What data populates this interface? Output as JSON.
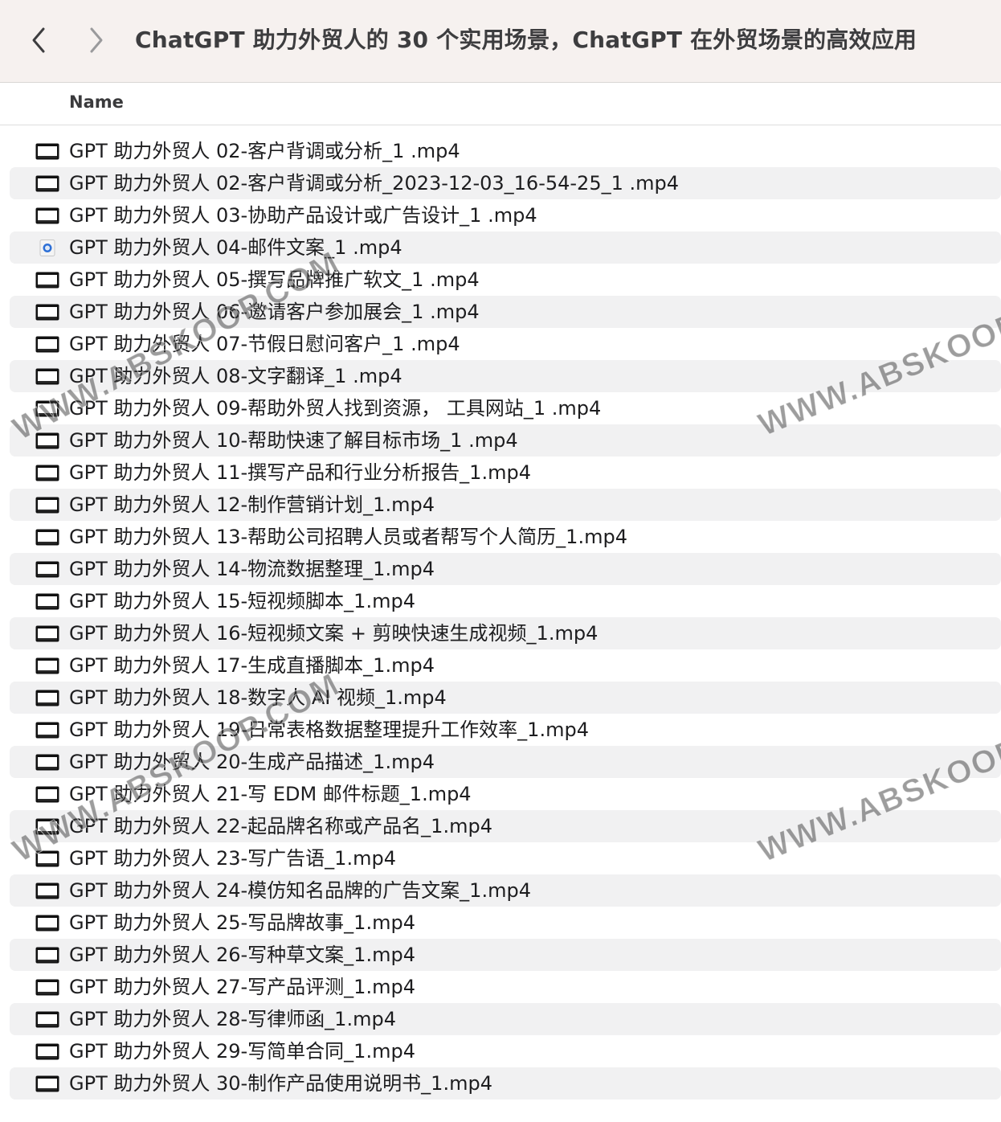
{
  "window": {
    "title": "ChatGPT 助力外贸人的 30 个实用场景，ChatGPT 在外贸场景的高效应用"
  },
  "columns": {
    "name": "Name"
  },
  "files": [
    {
      "name": "GPT 助力外贸人 02-客户背调或分析_1 .mp4",
      "icon": "video-file-icon"
    },
    {
      "name": "GPT 助力外贸人 02-客户背调或分析_2023-12-03_16-54-25_1 .mp4",
      "icon": "video-file-icon"
    },
    {
      "name": "GPT 助力外贸人 03-协助产品设计或广告设计_1 .mp4",
      "icon": "video-file-icon"
    },
    {
      "name": "GPT 助力外贸人 04-邮件文案_1 .mp4",
      "icon": "quicktime-file-icon"
    },
    {
      "name": "GPT 助力外贸人 05-撰写品牌推广软文_1 .mp4",
      "icon": "video-file-icon"
    },
    {
      "name": "GPT 助力外贸人 06-邀请客户参加展会_1 .mp4",
      "icon": "video-file-icon"
    },
    {
      "name": "GPT 助力外贸人 07-节假日慰问客户_1 .mp4",
      "icon": "video-file-icon"
    },
    {
      "name": "GPT 助力外贸人 08-文字翻译_1 .mp4",
      "icon": "video-file-icon"
    },
    {
      "name": "GPT 助力外贸人 09-帮助外贸人找到资源， 工具网站_1 .mp4",
      "icon": "video-file-icon"
    },
    {
      "name": "GPT 助力外贸人 10-帮助快速了解目标市场_1 .mp4",
      "icon": "video-file-icon"
    },
    {
      "name": "GPT 助力外贸人 11-撰写产品和行业分析报告_1.mp4",
      "icon": "video-file-icon"
    },
    {
      "name": "GPT 助力外贸人 12-制作营销计划_1.mp4",
      "icon": "video-file-icon"
    },
    {
      "name": "GPT 助力外贸人 13-帮助公司招聘人员或者帮写个人简历_1.mp4",
      "icon": "video-file-icon"
    },
    {
      "name": "GPT 助力外贸人 14-物流数据整理_1.mp4",
      "icon": "video-file-icon"
    },
    {
      "name": "GPT 助力外贸人 15-短视频脚本_1.mp4",
      "icon": "video-file-icon"
    },
    {
      "name": "GPT 助力外贸人 16-短视频文案 + 剪映快速生成视频_1.mp4",
      "icon": "video-file-icon"
    },
    {
      "name": "GPT 助力外贸人 17-生成直播脚本_1.mp4",
      "icon": "video-file-icon"
    },
    {
      "name": "GPT 助力外贸人 18-数字人 AI 视频_1.mp4",
      "icon": "video-file-icon"
    },
    {
      "name": "GPT 助力外贸人 19-日常表格数据整理提升工作效率_1.mp4",
      "icon": "video-file-icon"
    },
    {
      "name": "GPT 助力外贸人 20-生成产品描述_1.mp4",
      "icon": "video-file-icon"
    },
    {
      "name": "GPT 助力外贸人 21-写 EDM 邮件标题_1.mp4",
      "icon": "video-file-icon"
    },
    {
      "name": "GPT 助力外贸人 22-起品牌名称或产品名_1.mp4",
      "icon": "video-file-icon"
    },
    {
      "name": "GPT 助力外贸人 23-写广告语_1.mp4",
      "icon": "video-file-icon"
    },
    {
      "name": "GPT 助力外贸人 24-模仿知名品牌的广告文案_1.mp4",
      "icon": "video-file-icon"
    },
    {
      "name": "GPT 助力外贸人 25-写品牌故事_1.mp4",
      "icon": "video-file-icon"
    },
    {
      "name": "GPT 助力外贸人 26-写种草文案_1.mp4",
      "icon": "video-file-icon"
    },
    {
      "name": "GPT 助力外贸人 27-写产品评测_1.mp4",
      "icon": "video-file-icon"
    },
    {
      "name": "GPT 助力外贸人 28-写律师函_1.mp4",
      "icon": "video-file-icon"
    },
    {
      "name": "GPT 助力外贸人 29-写简单合同_1.mp4",
      "icon": "video-file-icon"
    },
    {
      "name": "GPT 助力外贸人 30-制作产品使用说明书_1.mp4",
      "icon": "video-file-icon"
    }
  ],
  "watermarks": [
    "WWW.ABSKOOP.COM",
    "WWW.ABSKOOP.COM",
    "WWW.ABSKOOP.COM",
    "WWW.ABSKOOP.COM"
  ],
  "colors": {
    "toolbar_bg": "#f6f1ef",
    "row_stripe": "#f1f1f2",
    "text": "#1d1d1f"
  }
}
